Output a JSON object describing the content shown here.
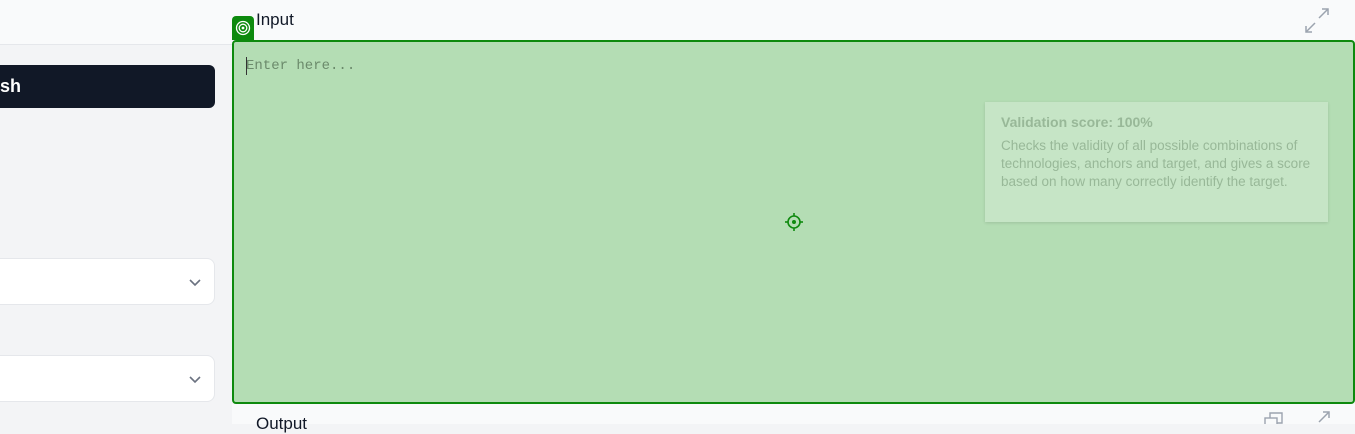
{
  "sidebar": {
    "primary_button_label": "sh"
  },
  "input_panel": {
    "title": "Input",
    "placeholder": "Enter here...",
    "badge_icon": "target-icon",
    "expand_icon": "expand-icon",
    "accent_color": "#0e8a0e",
    "fill_color": "#b4ddb4"
  },
  "tooltip": {
    "title": "Validation score: 100%",
    "body": "Checks the validity of all possible combinations of technologies, anchors and target, and gives a score based on how many correctly identify the target."
  },
  "output_panel": {
    "title": "Output"
  }
}
